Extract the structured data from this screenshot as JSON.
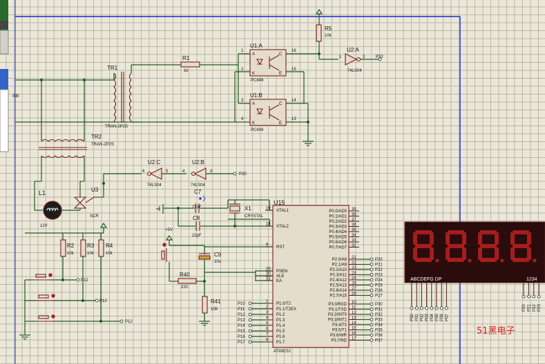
{
  "labels": {
    "ine": "INE",
    "tr1": "TR1",
    "tr1_type": "TRAN-2P2S",
    "tr2": "TR2",
    "tr2_type": "TRAN-2P2S",
    "r1": "R1",
    "r1_val": "1k",
    "r5": "R5",
    "r5_val": "10k",
    "u1a": "U1:A",
    "u1b": "U1:B",
    "pc849": "PC849",
    "u2a": "U2:A",
    "u2b": "U2:B",
    "u2c": "U2:C",
    "ls04": "74LS04",
    "p32": "P32",
    "p30": "P30",
    "u3": "U3",
    "scr": "SCR",
    "l1": "L1",
    "l1_val": "12V",
    "c7": "C7",
    "c8": "C8",
    "c9": "C9",
    "c_val": "22pF",
    "c9_val": "10u",
    "x1": "X1",
    "x1_type": "CRYSTAL",
    "u15": "U15",
    "chip": "AT89C52",
    "r2": "R2",
    "r3": "R3",
    "r4": "R4",
    "r_val": "10k",
    "r40": "R40",
    "r40_val": "220",
    "r41": "R41",
    "r41_val": "10K",
    "vcc": "+5V",
    "p12": "P12",
    "disp_left": "ABCDEFG DP",
    "disp_right": "1234",
    "watermark": "51黑电子"
  },
  "pin_numbers": {
    "u1a": [
      "1",
      "2",
      "16",
      "15"
    ],
    "u1b": [
      "3",
      "4",
      "14",
      "13"
    ],
    "u2a": [
      "1",
      "2"
    ],
    "u2b": [
      "4",
      "3"
    ],
    "u2c": [
      "6",
      "5"
    ],
    "u15_left": [
      "19",
      "18",
      "9",
      "29",
      "30",
      "31",
      "1",
      "2",
      "3",
      "4",
      "5",
      "6",
      "7",
      "8"
    ],
    "u15_right": [
      "39",
      "38",
      "37",
      "36",
      "35",
      "34",
      "33",
      "32",
      "21",
      "22",
      "23",
      "24",
      "25",
      "26",
      "27",
      "28",
      "10",
      "11",
      "12",
      "13",
      "14",
      "15",
      "16",
      "17"
    ]
  },
  "u15_left_pins": [
    "XTAL1",
    "XTAL2",
    "RST",
    "PSEN",
    "ALE",
    "EA",
    "P1.0/T2",
    "P1.1/T2EX",
    "P1.2",
    "P1.3",
    "P1.4",
    "P1.5",
    "P1.6",
    "P1.7"
  ],
  "u15_right_pins": [
    "P0.0/AD0",
    "P0.1/AD1",
    "P0.2/AD2",
    "P0.3/AD3",
    "P0.4/AD4",
    "P0.5/AD5",
    "P0.6/AD6",
    "P0.7/AD7",
    "P2.0/A8",
    "P2.1/A9",
    "P2.2/A10",
    "P2.3/A11",
    "P2.4/A12",
    "P2.5/A13",
    "P2.6/A14",
    "P2.7/A15",
    "P3.0/RXD",
    "P3.1/TXD",
    "P3.2/INT0",
    "P3.3/INT1",
    "P3.4/T0",
    "P3.5/T1",
    "P3.6/WR",
    "P3.7/RD"
  ],
  "p1_net": [
    "P10",
    "P11",
    "P12",
    "P13",
    "P14",
    "P15",
    "P16",
    "P17"
  ],
  "p2_net": [
    "P20",
    "P21",
    "P22",
    "P23",
    "P24",
    "P25",
    "P26",
    "P27"
  ],
  "p3_net": [
    "P30",
    "P31",
    "P32",
    "P33",
    "P34",
    "P35",
    "P36",
    "P37"
  ],
  "seg_net": [
    "P00",
    "P01",
    "P02",
    "P03",
    "P04",
    "P05",
    "P06",
    "P07"
  ],
  "digit_net": [
    "P20",
    "P21",
    "P22",
    "P23"
  ],
  "display_digits": 4,
  "colors": {
    "wire": "#1f5a1f",
    "component": "#7a1f1f",
    "grid": "#b9b6a6",
    "background": "#ebe8d9",
    "frame": "#1a2ad8",
    "segment_on": "#a51d1d",
    "display_body": "#2a0c0c",
    "watermark": "#d62020"
  }
}
